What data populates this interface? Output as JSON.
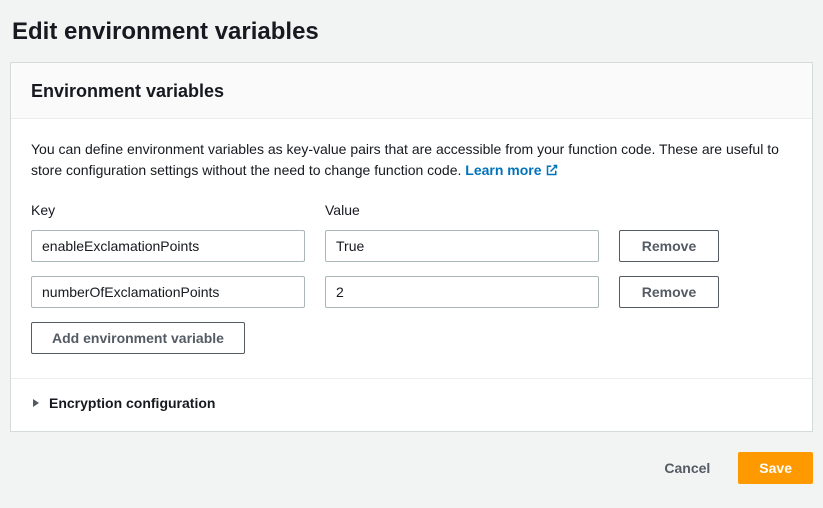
{
  "page": {
    "title": "Edit environment variables"
  },
  "panel": {
    "title": "Environment variables",
    "description_prefix": "You can define environment variables as key-value pairs that are accessible from your function code. These are useful to store configuration settings without the need to change function code. ",
    "learn_more": "Learn more",
    "key_label": "Key",
    "value_label": "Value",
    "rows": [
      {
        "key": "enableExclamationPoints",
        "value": "True",
        "remove_label": "Remove"
      },
      {
        "key": "numberOfExclamationPoints",
        "value": "2",
        "remove_label": "Remove"
      }
    ],
    "add_button": "Add environment variable",
    "encryption_title": "Encryption configuration"
  },
  "footer": {
    "cancel": "Cancel",
    "save": "Save"
  }
}
